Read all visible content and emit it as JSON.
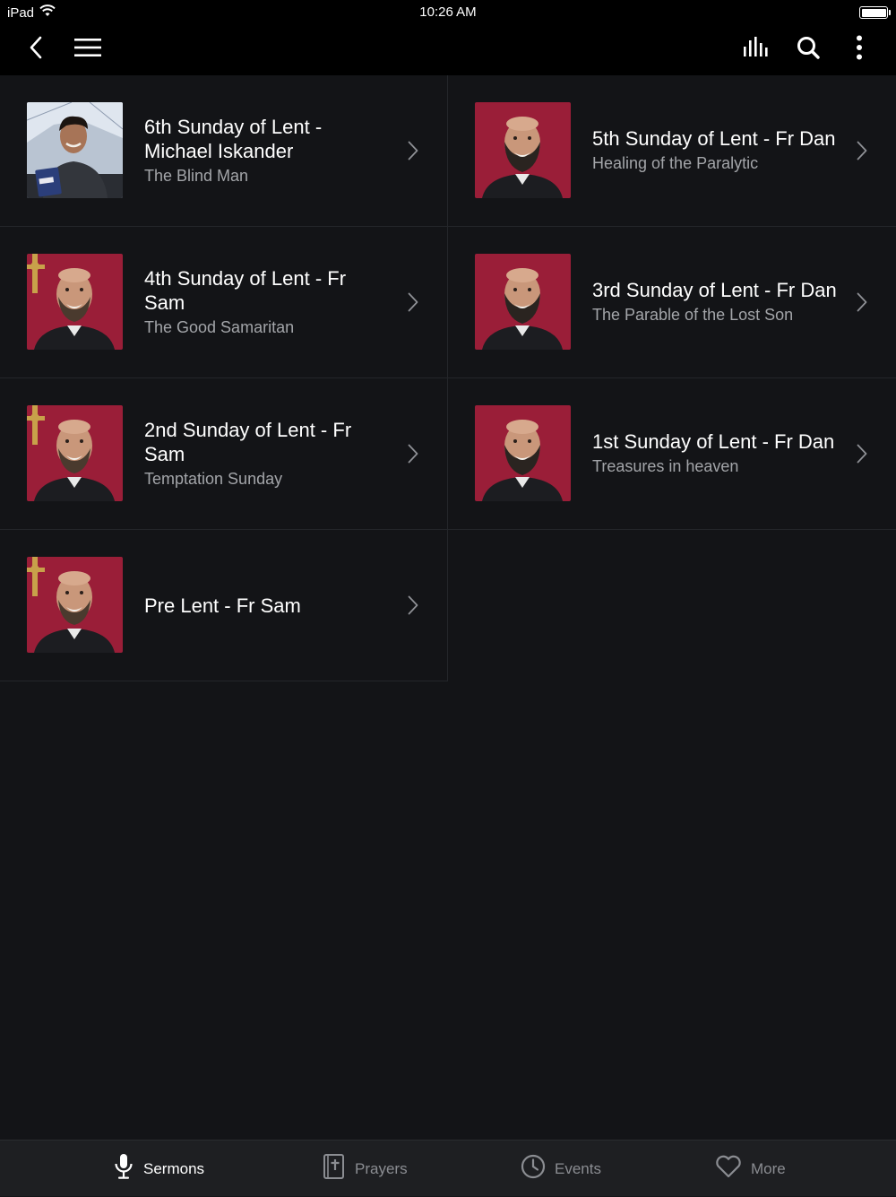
{
  "status_bar": {
    "device": "iPad",
    "time": "10:26 AM"
  },
  "nav": {
    "back_icon": "chevron-left-icon",
    "menu_icon": "hamburger-menu-icon",
    "audio_icon": "audio-bars-icon",
    "search_icon": "search-icon",
    "more_icon": "vertical-ellipsis-icon"
  },
  "sermons": [
    {
      "title": "6th Sunday of Lent - Michael Iskander",
      "subtitle": "The Blind Man",
      "thumb": "michael"
    },
    {
      "title": "5th Sunday of Lent - Fr Dan",
      "subtitle": "Healing of the Paralytic",
      "thumb": "dan"
    },
    {
      "title": "4th Sunday of Lent - Fr Sam",
      "subtitle": "The Good Samaritan",
      "thumb": "sam"
    },
    {
      "title": "3rd Sunday of Lent - Fr Dan",
      "subtitle": "The Parable of the Lost Son",
      "thumb": "dan"
    },
    {
      "title": "2nd Sunday of Lent - Fr Sam",
      "subtitle": "Temptation Sunday",
      "thumb": "sam"
    },
    {
      "title": "1st Sunday of Lent - Fr Dan",
      "subtitle": "Treasures in heaven",
      "thumb": "dan"
    },
    {
      "title": "Pre Lent - Fr Sam",
      "subtitle": "",
      "thumb": "sam"
    }
  ],
  "tabs": [
    {
      "label": "Sermons",
      "icon": "microphone-icon",
      "active": true
    },
    {
      "label": "Prayers",
      "icon": "bible-icon",
      "active": false
    },
    {
      "label": "Events",
      "icon": "clock-icon",
      "active": false
    },
    {
      "label": "More",
      "icon": "heart-icon",
      "active": false
    }
  ],
  "colors": {
    "background": "#131417",
    "bar": "#000000",
    "tab_bar": "#1e1f22",
    "subtitle": "#a3a5a9",
    "inactive_tab": "#8b8d92",
    "photo_backdrop": "#9a1e38"
  }
}
